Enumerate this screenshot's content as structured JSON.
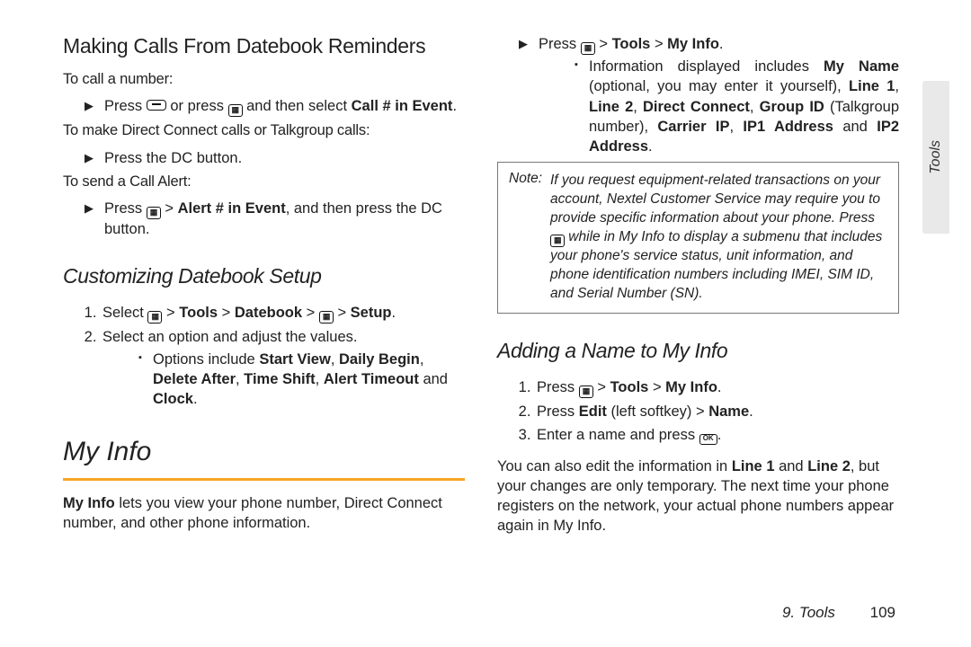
{
  "side_tab": {
    "label": "Tools"
  },
  "left": {
    "h1": "Making Calls From Datebook Reminders",
    "to_call": "To call a number:",
    "b_call_prefix": "Press ",
    "b_call_mid": " or press ",
    "b_call_tail": " and then select ",
    "b_call_bold": "Call # in Event",
    "b_call_end": ".",
    "to_dc": "To make Direct Connect calls or Talkgroup calls:",
    "b_dc": "Press the DC button.",
    "to_alert": "To send a Call Alert:",
    "b_alert_prefix": "Press ",
    "b_alert_gt": " > ",
    "b_alert_bold": "Alert # in Event",
    "b_alert_tail": ", and then press the DC button.",
    "h2": "Customizing Datebook Setup",
    "s1_prefix": "Select ",
    "s1_gt": " > ",
    "s1_b1": "Tools",
    "s1_b2": "Datebook",
    "s1_b3": "Setup",
    "s1_end": ".",
    "s2": "Select an option and adjust the values.",
    "s2_opt_prefix": "Options include ",
    "s2_b1": "Start View",
    "s2_b2": "Daily Begin",
    "s2_b3": "Delete After",
    "s2_b4": "Time Shift",
    "s2_b5": "Alert Timeout",
    "s2_and": " and ",
    "s2_b6": "Clock",
    "s2_end": ".",
    "h_major": "My Info",
    "myinfo_b": "My Info",
    "myinfo_rest": " lets you view your phone number, Direct Connect number, and other phone information."
  },
  "right": {
    "r1_prefix": "Press ",
    "r1_gt": " > ",
    "r1_b1": "Tools",
    "r1_b2": "My Info",
    "r1_end": ".",
    "r2_prefix": "Information displayed includes ",
    "r2_b1": "My Name",
    "r2_opt": " (optional, you may enter it yourself), ",
    "r2_b2": "Line 1",
    "r2_c": ", ",
    "r2_b3": "Line 2",
    "r2_b4": "Direct Connect",
    "r2_b5": "Group ID",
    "r2_tg": " (Talkgroup number), ",
    "r2_b6": "Carrier IP",
    "r2_b7": "IP1 Address",
    "r2_and": " and ",
    "r2_b8": "IP2 Address",
    "r2_end": ".",
    "note_label": "Note:",
    "note_l1": "If you request equipment-related transactions on your account, Nextel Customer Service may require you to provide specific information about your phone. Press ",
    "note_l2": " while in My Info to display a submenu that includes your phone's service status, unit information, and phone identification numbers including IMEI, SIM ID, and Serial Number (SN).",
    "h3": "Adding a Name to My Info",
    "a1_prefix": "Press ",
    "a1_gt": " > ",
    "a1_b1": "Tools",
    "a1_b2": "My Info",
    "a1_end": ".",
    "a2_prefix": "Press ",
    "a2_b1": "Edit",
    "a2_mid": " (left softkey) > ",
    "a2_b2": "Name",
    "a2_end": ".",
    "a3_prefix": "Enter a name and press ",
    "a3_end": ".",
    "tail_pre": "You can also edit the information in ",
    "tail_b1": "Line 1",
    "tail_and": " and ",
    "tail_b2": "Line 2",
    "tail_post": ", but your changes are only temporary. The next time your phone registers on the network, your actual phone numbers appear again in My Info."
  },
  "footer": {
    "chapter": "9. Tools",
    "page": "109"
  },
  "icons": {
    "ok": "OK",
    "grid": "▦"
  }
}
